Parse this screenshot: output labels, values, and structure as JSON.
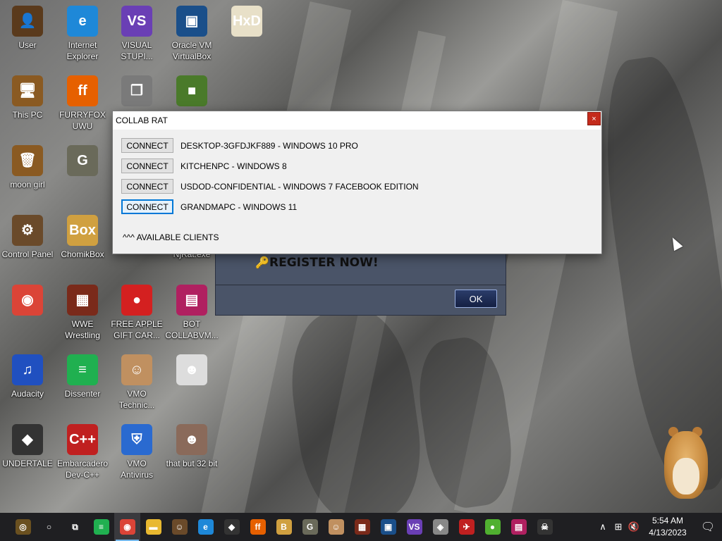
{
  "desktop": {
    "icons": [
      {
        "label": "User",
        "icon": "user-folder-icon",
        "color": "#5a3a1c",
        "glyph": "👤"
      },
      {
        "label": "Internet Explorer",
        "icon": "edge-icon",
        "color": "#1e88d8",
        "glyph": "e"
      },
      {
        "label": "VISUAL STUPI...",
        "icon": "visual-studio-icon",
        "color": "#6a3fb5",
        "glyph": "VS"
      },
      {
        "label": "Oracle VM VirtualBox",
        "icon": "virtualbox-icon",
        "color": "#1a4f8a",
        "glyph": "▣"
      },
      {
        "label": "",
        "icon": "hxd-icon",
        "color": "#e8e0c8",
        "glyph": "HxD"
      },
      {
        "label": "This PC",
        "icon": "this-pc-icon",
        "color": "#8a5a22",
        "glyph": "🖥"
      },
      {
        "label": "FURRYFOX UWU",
        "icon": "firefox-icon",
        "color": "#e66000",
        "glyph": "ff"
      },
      {
        "label": "",
        "icon": "copy-icon",
        "color": "#7a7a7a",
        "glyph": "❐"
      },
      {
        "label": "",
        "icon": "minecraft-icon",
        "color": "#4a7a2a",
        "glyph": "■"
      },
      {
        "label": "moon girl",
        "icon": "recycle-bin-icon",
        "color": "#8a5a22",
        "glyph": "🗑"
      },
      {
        "label": "",
        "icon": "gimp-icon",
        "color": "#6a6a5a",
        "glyph": "G"
      },
      {
        "label": "Control Panel",
        "icon": "control-panel-icon",
        "color": "#6a4a2a",
        "glyph": "⚙"
      },
      {
        "label": "ChomikBox",
        "icon": "chomikbox-icon",
        "color": "#d0a040",
        "glyph": "Box"
      },
      {
        "label": "",
        "icon": "app-icon",
        "color": "#555555",
        "glyph": "?"
      },
      {
        "label": "NjRat.exe",
        "icon": "njrat-icon",
        "color": "#555555",
        "glyph": "?"
      },
      {
        "label": "",
        "icon": "chrome-icon",
        "color": "#db4437",
        "glyph": "◉"
      },
      {
        "label": "WWE Wrestling",
        "icon": "wwe-icon",
        "color": "#7a2a1a",
        "glyph": "▦"
      },
      {
        "label": "FREE APPLE GIFT CAR...",
        "icon": "apple-icon",
        "color": "#d42020",
        "glyph": "●"
      },
      {
        "label": "BOT COLLABVM...",
        "icon": "bot-icon",
        "color": "#b02060",
        "glyph": "▤"
      },
      {
        "label": "Audacity",
        "icon": "audacity-icon",
        "color": "#2050c0",
        "glyph": "♫"
      },
      {
        "label": "Dissenter",
        "icon": "dissenter-icon",
        "color": "#20b050",
        "glyph": "≡"
      },
      {
        "label": "VMO Technic...",
        "icon": "technician-icon",
        "color": "#c09060",
        "glyph": "☺"
      },
      {
        "label": "",
        "icon": "face-image-icon",
        "color": "#dddddd",
        "glyph": "☻"
      },
      {
        "label": "UNDERTALE",
        "icon": "unity-icon",
        "color": "#333333",
        "glyph": "◆"
      },
      {
        "label": "Embarcadero Dev-C++",
        "icon": "devcpp-icon",
        "color": "#c02020",
        "glyph": "C++"
      },
      {
        "label": "VMO Antivirus",
        "icon": "shield-icon",
        "color": "#2a6ad0",
        "glyph": "⛨"
      },
      {
        "label": "that but 32 bit",
        "icon": "portrait-icon",
        "color": "#8a6a5a",
        "glyph": "☻"
      }
    ]
  },
  "back_dialog": {
    "register_text": "REGISTER NOW!",
    "ok_label": "OK"
  },
  "window": {
    "title": "COLLAB RAT",
    "close_glyph": "×",
    "clients": [
      {
        "button": "CONNECT",
        "name": "DESKTOP-3GFDJKF889 - WINDOWS 10 PRO"
      },
      {
        "button": "CONNECT",
        "name": "KITCHENPC - WINDOWS 8"
      },
      {
        "button": "CONNECT",
        "name": "USDOD-CONFIDENTIAL - WINDOWS 7 FACEBOOK EDITION"
      },
      {
        "button": "CONNECT",
        "name": "GRANDMAPC - WINDOWS 11"
      }
    ],
    "available_label": "^^^ AVAILABLE CLIENTS"
  },
  "taskbar": {
    "items": [
      {
        "icon": "start-orb-icon",
        "glyph": "◎",
        "color": "#6a5020"
      },
      {
        "icon": "search-circle-icon",
        "glyph": "○",
        "color": "transparent"
      },
      {
        "icon": "task-view-icon",
        "glyph": "⧉",
        "color": "transparent"
      },
      {
        "icon": "dissenter-icon",
        "glyph": "≡",
        "color": "#20b050"
      },
      {
        "icon": "chrome-icon",
        "glyph": "◉",
        "color": "#db4437"
      },
      {
        "icon": "file-explorer-icon",
        "glyph": "▬",
        "color": "#e8b830"
      },
      {
        "icon": "user-icon",
        "glyph": "☺",
        "color": "#6a4a2a"
      },
      {
        "icon": "edge-icon",
        "glyph": "e",
        "color": "#1e88d8"
      },
      {
        "icon": "unity-icon",
        "glyph": "◆",
        "color": "#333333"
      },
      {
        "icon": "firefox-icon",
        "glyph": "ff",
        "color": "#e66000"
      },
      {
        "icon": "chomikbox-icon",
        "glyph": "B",
        "color": "#d0a040"
      },
      {
        "icon": "gimp-icon",
        "glyph": "G",
        "color": "#6a6a5a"
      },
      {
        "icon": "technician-icon",
        "glyph": "☺",
        "color": "#c09060"
      },
      {
        "icon": "wwe-icon",
        "glyph": "▦",
        "color": "#7a2a1a"
      },
      {
        "icon": "virtualbox-icon",
        "glyph": "▣",
        "color": "#1a4f8a"
      },
      {
        "icon": "visual-studio-icon",
        "glyph": "VS",
        "color": "#6a3fb5"
      },
      {
        "icon": "tool-icon",
        "glyph": "◈",
        "color": "#888888"
      },
      {
        "icon": "bird-icon",
        "glyph": "✈",
        "color": "#c02020"
      },
      {
        "icon": "melon-icon",
        "glyph": "●",
        "color": "#50b030"
      },
      {
        "icon": "bot-icon",
        "glyph": "▤",
        "color": "#b02060"
      },
      {
        "icon": "skull-icon",
        "glyph": "☠",
        "color": "#333333"
      }
    ],
    "active_index": 4,
    "tray": {
      "chevron": "∧",
      "network": "⊞",
      "volume": "🔇",
      "time": "5:54 AM",
      "date": "4/13/2023",
      "notification": "🗨"
    }
  }
}
